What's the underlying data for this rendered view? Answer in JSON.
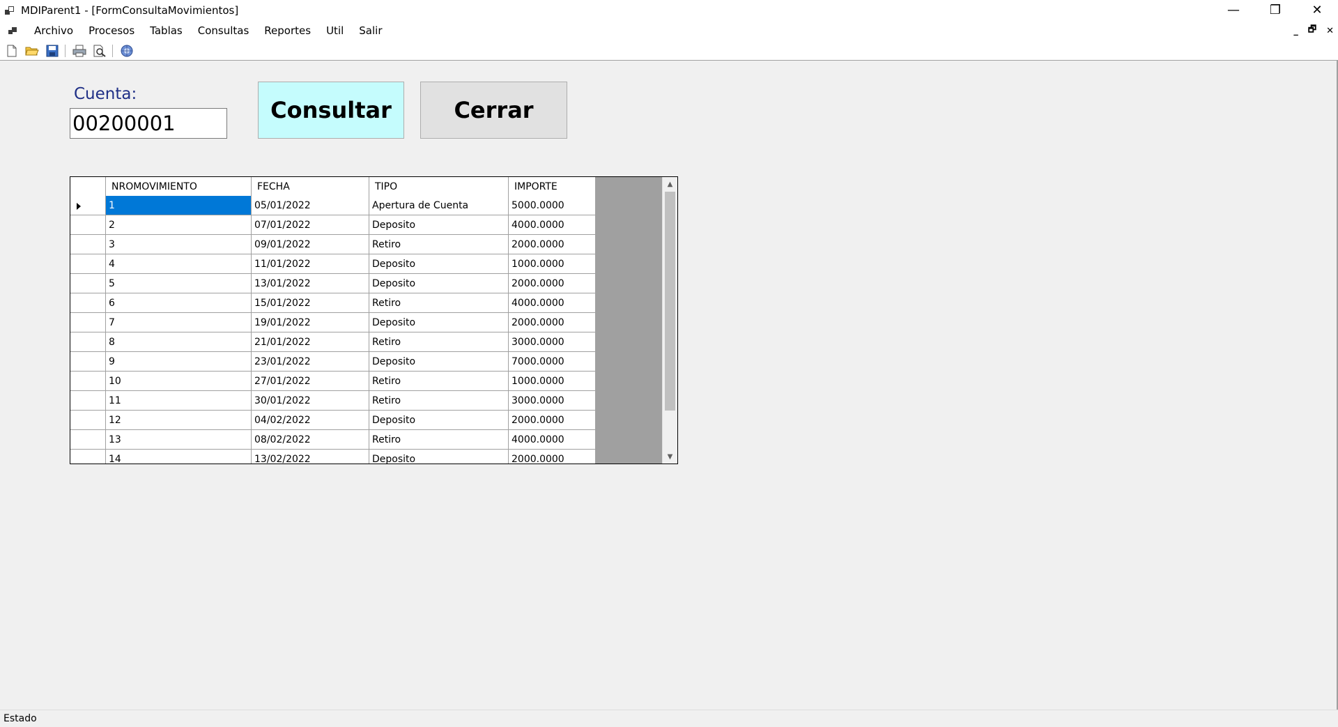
{
  "window": {
    "title": "MDIParent1 - [FormConsultaMovimientos]",
    "controls": {
      "minimize": "—",
      "restore": "❐",
      "close": "✕"
    }
  },
  "menu": {
    "items": [
      "Archivo",
      "Procesos",
      "Tablas",
      "Consultas",
      "Reportes",
      "Util",
      "Salir"
    ],
    "mdi_controls": {
      "minimize": "_",
      "restore": "🗗",
      "close": "✕"
    }
  },
  "toolbar": {
    "buttons": [
      "new-icon",
      "open-icon",
      "save-icon",
      "print-icon",
      "print-preview-icon",
      "help-icon"
    ]
  },
  "form": {
    "cuenta_label": "Cuenta:",
    "cuenta_value": "00200001",
    "consultar_label": "Consultar",
    "cerrar_label": "Cerrar"
  },
  "grid": {
    "columns": [
      "NROMOVIMIENTO",
      "FECHA",
      "TIPO",
      "IMPORTE"
    ],
    "selected_row": 0,
    "rows": [
      [
        "1",
        "05/01/2022",
        "Apertura de Cuenta",
        "5000.0000"
      ],
      [
        "2",
        "07/01/2022",
        "Deposito",
        "4000.0000"
      ],
      [
        "3",
        "09/01/2022",
        "Retiro",
        "2000.0000"
      ],
      [
        "4",
        "11/01/2022",
        "Deposito",
        "1000.0000"
      ],
      [
        "5",
        "13/01/2022",
        "Deposito",
        "2000.0000"
      ],
      [
        "6",
        "15/01/2022",
        "Retiro",
        "4000.0000"
      ],
      [
        "7",
        "19/01/2022",
        "Deposito",
        "2000.0000"
      ],
      [
        "8",
        "21/01/2022",
        "Retiro",
        "3000.0000"
      ],
      [
        "9",
        "23/01/2022",
        "Deposito",
        "7000.0000"
      ],
      [
        "10",
        "27/01/2022",
        "Retiro",
        "1000.0000"
      ],
      [
        "11",
        "30/01/2022",
        "Retiro",
        "3000.0000"
      ],
      [
        "12",
        "04/02/2022",
        "Deposito",
        "2000.0000"
      ],
      [
        "13",
        "08/02/2022",
        "Retiro",
        "4000.0000"
      ],
      [
        "14",
        "13/02/2022",
        "Deposito",
        "2000.0000"
      ]
    ]
  },
  "status": {
    "text": "Estado"
  },
  "colors": {
    "accent_button": "#c5fcfd",
    "selection": "#0078d7",
    "label": "#1f2f86"
  }
}
